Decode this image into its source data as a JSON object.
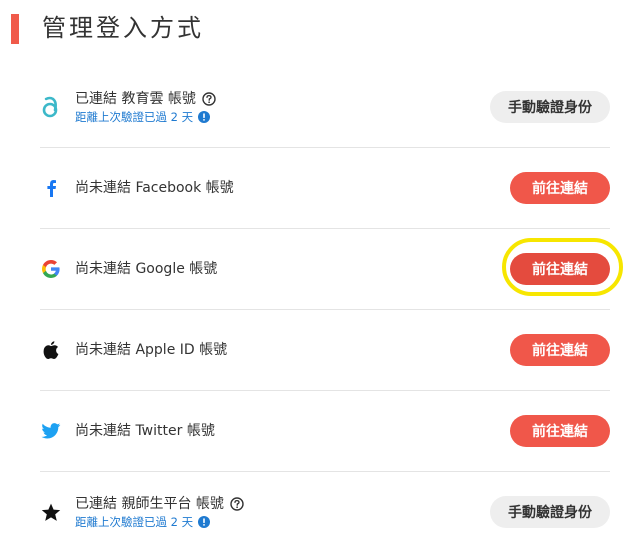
{
  "page": {
    "title": "管理登入方式"
  },
  "rows": [
    {
      "id": "cooc",
      "icon": "cooc-cloud-logo-icon",
      "label": "已連結 教育雲 帳號",
      "sub": "距離上次驗證已過 2 天",
      "action": "手動驗證身份",
      "status": "connected"
    },
    {
      "id": "facebook",
      "icon": "facebook-icon",
      "label": "尚未連結 Facebook 帳號",
      "action": "前往連結",
      "status": "not-connected"
    },
    {
      "id": "google",
      "icon": "google-icon",
      "label": "尚未連結 Google 帳號",
      "action": "前往連結",
      "status": "not-connected"
    },
    {
      "id": "apple",
      "icon": "apple-icon",
      "label": "尚未連結 Apple ID 帳號",
      "action": "前往連結",
      "status": "not-connected"
    },
    {
      "id": "twitter",
      "icon": "twitter-icon",
      "label": "尚未連結 Twitter 帳號",
      "action": "前往連結",
      "status": "not-connected"
    },
    {
      "id": "teacher-platform",
      "icon": "star-icon",
      "label": "已連結 親師生平台 帳號",
      "sub": "距離上次驗證已過 2 天",
      "action": "手動驗證身份",
      "status": "connected"
    }
  ],
  "colors": {
    "accent": "#f05a4a",
    "connect_button": "#f0574a",
    "link_text": "#1f7ad0",
    "highlight": "#f7e600"
  }
}
